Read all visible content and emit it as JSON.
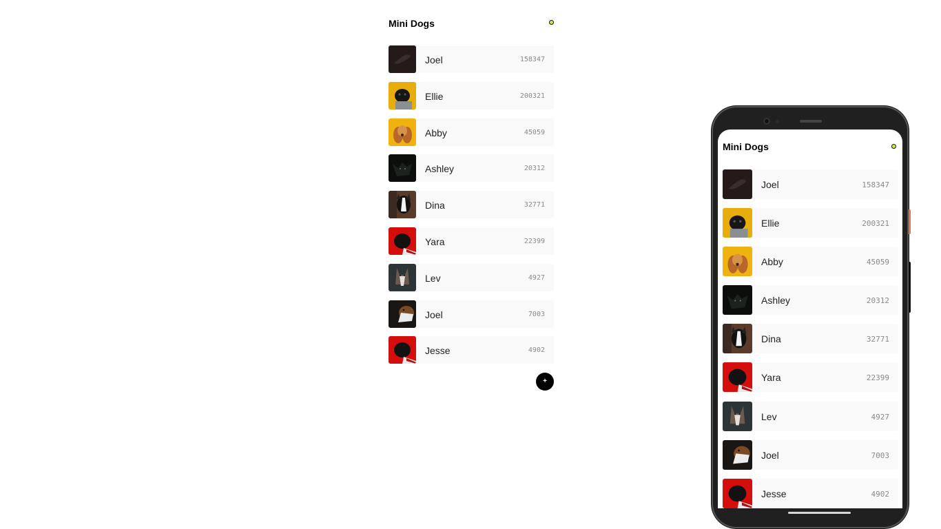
{
  "app": {
    "title": "Mini Dogs",
    "add_button_label": "+",
    "status_color": "#c8f23a"
  },
  "dogs": [
    {
      "name": "Joel",
      "count": "158347",
      "image": "dark-dog-photo"
    },
    {
      "name": "Ellie",
      "count": "200321",
      "image": "pug-yellow-photo"
    },
    {
      "name": "Abby",
      "count": "45059",
      "image": "spaniel-yellow-photo"
    },
    {
      "name": "Ashley",
      "count": "20312",
      "image": "black-dog-photo"
    },
    {
      "name": "Dina",
      "count": "32771",
      "image": "boston-terrier-photo"
    },
    {
      "name": "Yara",
      "count": "22399",
      "image": "pug-red-photo"
    },
    {
      "name": "Lev",
      "count": "4927",
      "image": "husky-photo"
    },
    {
      "name": "Joel",
      "count": "7003",
      "image": "brown-white-dog-photo"
    },
    {
      "name": "Jesse",
      "count": "4902",
      "image": "pug-red-photo"
    }
  ],
  "phone": {
    "title": "Mini Dogs",
    "dogs": [
      {
        "name": "Joel",
        "count": "158347"
      },
      {
        "name": "Ellie",
        "count": "200321"
      },
      {
        "name": "Abby",
        "count": "45059"
      },
      {
        "name": "Ashley",
        "count": "20312"
      },
      {
        "name": "Dina",
        "count": "32771"
      },
      {
        "name": "Yara",
        "count": "22399"
      },
      {
        "name": "Lev",
        "count": "4927"
      },
      {
        "name": "Joel",
        "count": "7003"
      },
      {
        "name": "Jesse",
        "count": "4902"
      }
    ]
  }
}
